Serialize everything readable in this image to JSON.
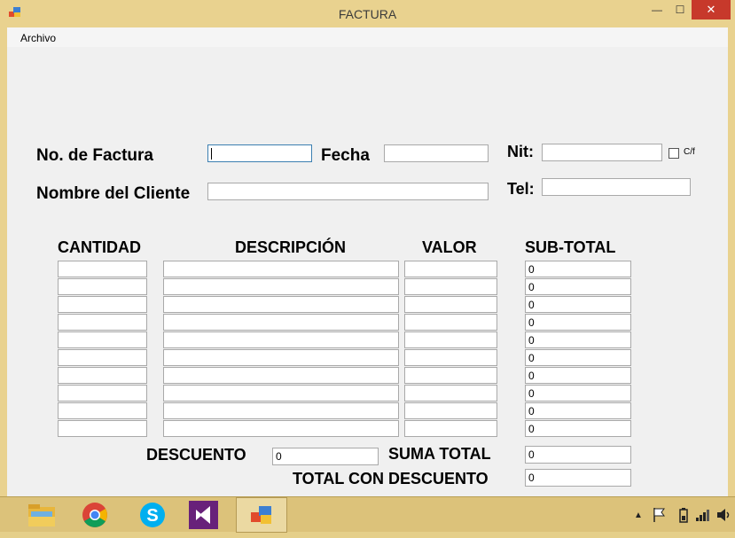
{
  "window": {
    "title": "FACTURA",
    "controls": {
      "minimize": "—",
      "maximize": "☐",
      "close": "✕"
    }
  },
  "menu": {
    "items": [
      "Archivo"
    ]
  },
  "form": {
    "labels": {
      "invoice_no": "No. de Factura",
      "date": "Fecha",
      "nit": "Nit:",
      "cf": "C/f",
      "client_name": "Nombre del Cliente",
      "tel": "Tel:"
    },
    "values": {
      "invoice_no": "",
      "date": "",
      "nit": "",
      "client_name": "",
      "tel": ""
    }
  },
  "table": {
    "headers": [
      "CANTIDAD",
      "DESCRIPCIÓN",
      "VALOR",
      "SUB-TOTAL"
    ],
    "rows": 10,
    "subtotals": [
      "0",
      "0",
      "0",
      "0",
      "0",
      "0",
      "0",
      "0",
      "0",
      "0"
    ]
  },
  "totals": {
    "discount_label": "DESCUENTO",
    "discount_value": "0",
    "sum_label": "SUMA TOTAL",
    "sum_value": "0",
    "total_discount_label": "TOTAL CON DESCUENTO",
    "total_discount_value": "0"
  },
  "taskbar": {
    "apps": [
      "file-explorer-icon",
      "chrome-icon",
      "skype-icon",
      "visual-studio-icon",
      "windows-forms-app-icon"
    ]
  }
}
